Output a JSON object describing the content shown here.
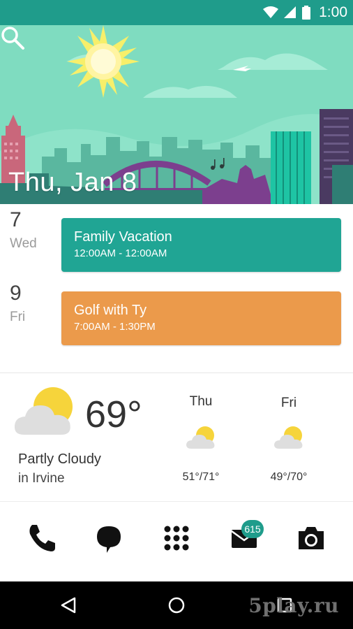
{
  "status_bar": {
    "time": "1:00",
    "icons": [
      "wifi-icon",
      "signal-icon",
      "battery-icon"
    ]
  },
  "header": {
    "date_title": "Thu, Jan 8",
    "search_icon": "search-icon"
  },
  "agenda": [
    {
      "day_number": "7",
      "day_name": "Wed",
      "event": {
        "title": "Family Vacation",
        "time": "12:00AM - 12:00AM",
        "color": "#20a594"
      }
    },
    {
      "day_number": "9",
      "day_name": "Fri",
      "event": {
        "title": "Golf with Ty",
        "time": "7:00AM - 1:30PM",
        "color": "#eb9a4b"
      }
    }
  ],
  "weather": {
    "current_temp": "69°",
    "condition": "Partly Cloudy",
    "location": "in Irvine",
    "icon": "partly-cloudy-icon",
    "forecast": [
      {
        "day": "Thu",
        "range": "51°/71°",
        "icon": "partly-cloudy-icon"
      },
      {
        "day": "Fri",
        "range": "49°/70°",
        "icon": "partly-cloudy-icon"
      }
    ]
  },
  "dock": {
    "apps": [
      "phone-icon",
      "messages-icon",
      "app-drawer-icon",
      "email-icon",
      "camera-icon"
    ],
    "email_badge": "615"
  },
  "nav_bar": {
    "buttons": [
      "back-icon",
      "home-icon",
      "recents-icon"
    ],
    "watermark": "5play.ru"
  },
  "colors": {
    "accent": "#1f9c8b",
    "sky": "#7fdcc0",
    "event_teal": "#20a594",
    "event_orange": "#eb9a4b"
  }
}
